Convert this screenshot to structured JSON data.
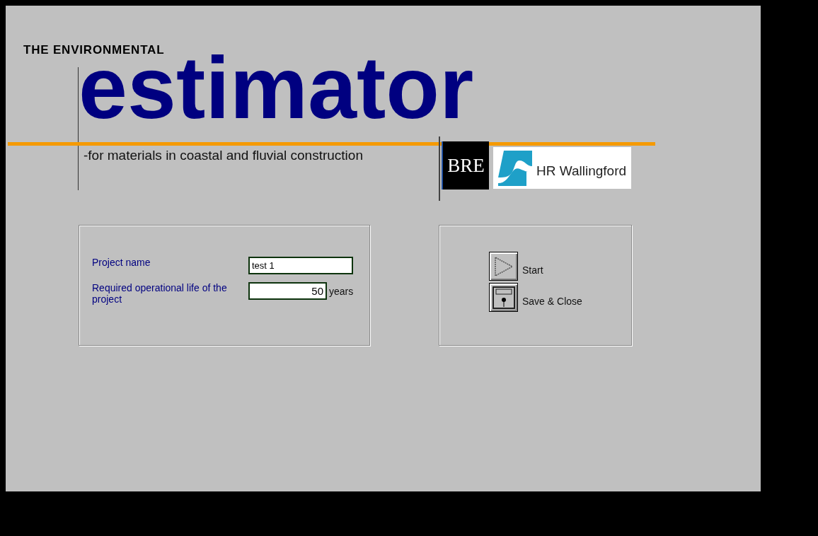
{
  "header": {
    "overline": "THE ENVIRONMENTAL",
    "title": "estimator",
    "subtitle": "-for materials in coastal and fluvial construction",
    "logos": [
      {
        "kind": "bre",
        "text": "BRE"
      },
      {
        "kind": "hr",
        "text": "HR Wallingford"
      }
    ]
  },
  "form": {
    "fields": [
      {
        "label": "Project name",
        "value": "test 1"
      },
      {
        "label": "Required operational life of the project",
        "value": "50",
        "unit": "years"
      }
    ]
  },
  "actions": [
    {
      "kind": "start",
      "label": "Start"
    },
    {
      "kind": "save",
      "label": "Save & Close"
    }
  ]
}
